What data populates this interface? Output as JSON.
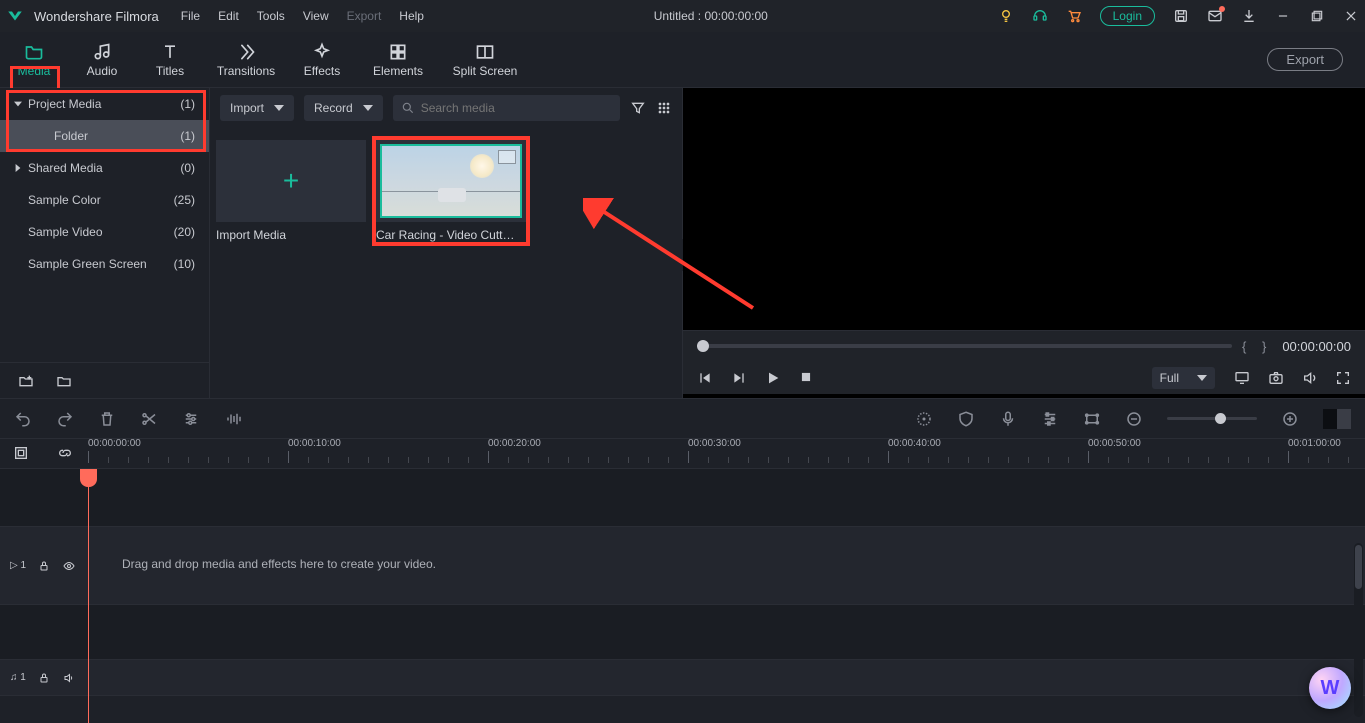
{
  "app": {
    "name": "Wondershare Filmora",
    "project_title": "Untitled : 00:00:00:00"
  },
  "menus": [
    "File",
    "Edit",
    "Tools",
    "View",
    "Export",
    "Help"
  ],
  "title_right": {
    "login": "Login"
  },
  "tabs": [
    {
      "label": "Media",
      "active": true
    },
    {
      "label": "Audio"
    },
    {
      "label": "Titles"
    },
    {
      "label": "Transitions"
    },
    {
      "label": "Effects"
    },
    {
      "label": "Elements"
    },
    {
      "label": "Split Screen"
    }
  ],
  "export_label": "Export",
  "sidebar": {
    "items": [
      {
        "label": "Project Media",
        "count": "(1)",
        "expanded": true
      },
      {
        "label": "Folder",
        "count": "(1)",
        "child": true,
        "active": true
      },
      {
        "label": "Shared Media",
        "count": "(0)",
        "expanded": false
      },
      {
        "label": "Sample Color",
        "count": "(25)"
      },
      {
        "label": "Sample Video",
        "count": "(20)"
      },
      {
        "label": "Sample Green Screen",
        "count": "(10)"
      }
    ]
  },
  "media_toolbar": {
    "import": "Import",
    "record": "Record",
    "search_placeholder": "Search media"
  },
  "media_tiles": {
    "import_label": "Import Media",
    "video_label": "Car Racing - Video Cutt…"
  },
  "preview": {
    "brackets": "{   }",
    "timecode": "00:00:00:00",
    "quality": "Full"
  },
  "ruler_times": [
    "00:00:00:00",
    "00:00:10:00",
    "00:00:20:00",
    "00:00:30:00",
    "00:00:40:00",
    "00:00:50:00",
    "00:01:00:00"
  ],
  "timeline": {
    "drop_hint": "Drag and drop media and effects here to create your video.",
    "video_track": "▷ 1",
    "audio_track": "♫ 1"
  }
}
